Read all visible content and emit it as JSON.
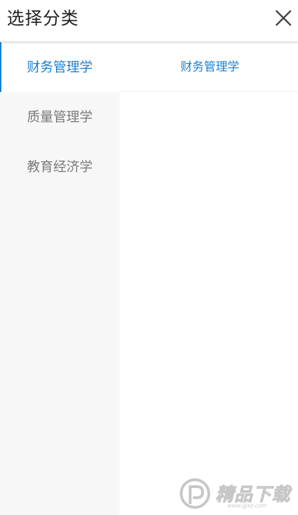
{
  "header": {
    "title": "选择分类",
    "close_icon": "close-icon"
  },
  "sidebar": {
    "items": [
      {
        "label": "财务管理学",
        "active": true
      },
      {
        "label": "质量管理学",
        "active": false
      },
      {
        "label": "教育经济学",
        "active": false
      }
    ]
  },
  "main": {
    "subitems": [
      {
        "label": "财务管理学"
      }
    ]
  },
  "watermark": {
    "text": "精品下载",
    "url": "www.jjjxz.com"
  },
  "colors": {
    "accent": "#1a7fd0",
    "sidebar_bg": "#f7f7f7",
    "inactive_text": "#7a7a7a"
  }
}
